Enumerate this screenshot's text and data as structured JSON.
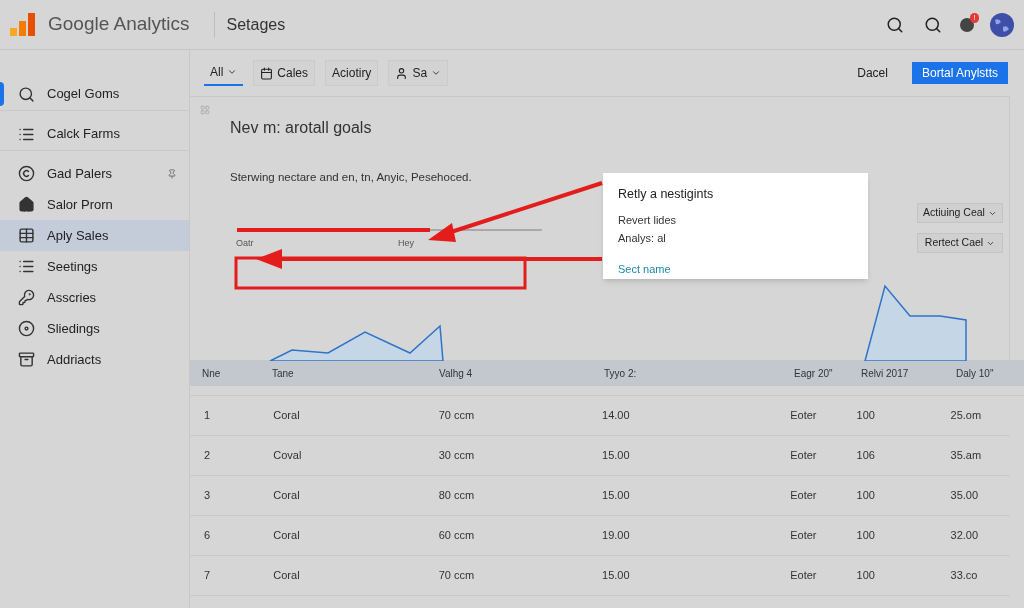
{
  "header": {
    "app_name": "Google Analytics",
    "page_title": "Setages",
    "notification_badge": "!"
  },
  "sidebar": {
    "items": [
      {
        "label": "Cogel Goms",
        "active": true,
        "selected": false
      },
      {
        "label": "Calck Farms",
        "active": false,
        "selected": false
      },
      {
        "label": "Gad Palers",
        "active": false,
        "selected": false
      },
      {
        "label": "Salor Prorn",
        "active": false,
        "selected": false
      },
      {
        "label": "Aply Sales",
        "active": false,
        "selected": true
      },
      {
        "label": "Seetings",
        "active": false,
        "selected": false
      },
      {
        "label": "Asscries",
        "active": false,
        "selected": false
      },
      {
        "label": "Sliedings",
        "active": false,
        "selected": false
      },
      {
        "label": "Addriacts",
        "active": false,
        "selected": false
      }
    ]
  },
  "toolbar": {
    "tabs": [
      {
        "label": "All",
        "selected": true
      },
      {
        "label": "Cales",
        "selected": false
      },
      {
        "label": "Aciotiry",
        "selected": false
      },
      {
        "label": "Sa",
        "selected": false
      }
    ],
    "cancel_button": "Dacel",
    "primary_button": "Bortal Anylstts"
  },
  "panel": {
    "title": "Nev m: arotall goals",
    "subtitle": "Sterwing nectare and en, tn, Anyic, Pesehoced.",
    "annotation_labels": [
      "Oatr",
      "Hey"
    ],
    "popover": {
      "title": "Retly a nestigints",
      "lines": [
        "Revert lides",
        "Analys: al"
      ],
      "link": "Sect name"
    },
    "dropdowns": [
      "Actiuing Ceal",
      "Rertect Cael"
    ]
  },
  "table": {
    "columns": [
      "Nne",
      "Tane",
      "Valhg 4",
      "Tyyo 2:",
      "Eagr 20\"",
      "Relvi 2017",
      "Daly 10\""
    ],
    "rows": [
      [
        "1",
        "Coral",
        "70 ccm",
        "14.00",
        "Eoter",
        "100",
        "25.om"
      ],
      [
        "2",
        "Coval",
        "30 ccm",
        "15.00",
        "Eoter",
        "106",
        "35.am"
      ],
      [
        "3",
        "Coral",
        "80 ccm",
        "15.00",
        "Eoter",
        "100",
        "35.00"
      ],
      [
        "6",
        "Coral",
        "60 ccm",
        "19.00",
        "Eoter",
        "100",
        "32.00"
      ],
      [
        "7",
        "Coral",
        "70 ccm",
        "15.00",
        "Eoter",
        "100",
        "33.co"
      ]
    ]
  }
}
